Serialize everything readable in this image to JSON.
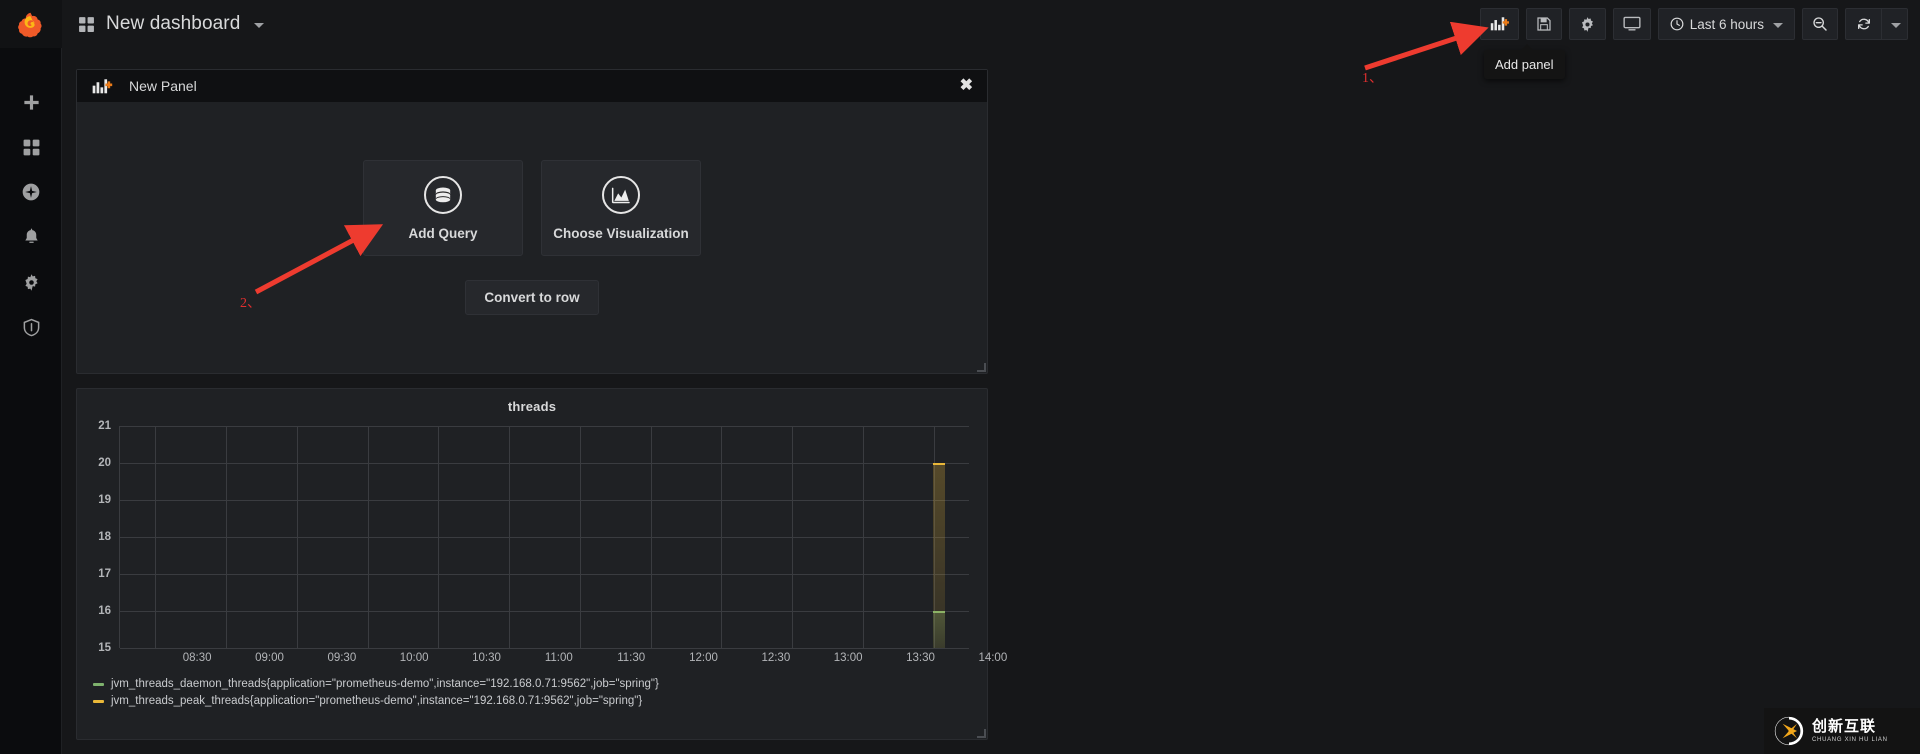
{
  "brand": {
    "logo": "grafana-logo",
    "accent": "#e0752d"
  },
  "sidebar": {
    "items": [
      {
        "name": "create",
        "icon": "plus-icon"
      },
      {
        "name": "dashboards",
        "icon": "dashboards-grid-icon"
      },
      {
        "name": "explore",
        "icon": "compass-icon"
      },
      {
        "name": "alerting",
        "icon": "bell-icon"
      },
      {
        "name": "configuration",
        "icon": "gear-icon"
      },
      {
        "name": "server-admin",
        "icon": "shield-icon"
      }
    ]
  },
  "topnav": {
    "grid_icon": "dashboard-grid-icon",
    "title": "New dashboard",
    "caret": "chevron-down-icon",
    "buttons": [
      {
        "name": "add-panel",
        "icon": "add-panel-icon",
        "tooltip": "Add panel"
      },
      {
        "name": "save-dashboard",
        "icon": "floppy-save-icon"
      },
      {
        "name": "dashboard-settings",
        "icon": "gear-icon"
      },
      {
        "name": "cycle-view-mode",
        "icon": "tv-monitor-icon"
      }
    ],
    "time_picker": {
      "icon": "clock-icon",
      "label": "Last 6 hours",
      "caret": "chevron-down-icon"
    },
    "zoom_out": {
      "name": "zoom-out",
      "icon": "search-minus-icon"
    },
    "refresh": {
      "name": "refresh",
      "icon": "refresh-icon"
    },
    "refresh_interval": {
      "name": "refresh-interval",
      "icon": "chevron-down-icon"
    }
  },
  "new_panel": {
    "header_icon": "add-panel-icon",
    "title": "New Panel",
    "close": "✖",
    "cards": [
      {
        "name": "add-query",
        "icon": "database-icon",
        "label": "Add Query"
      },
      {
        "name": "choose-visualization",
        "icon": "graph-area-icon",
        "label": "Choose Visualization"
      }
    ],
    "convert_label": "Convert to row"
  },
  "graph_panel": {
    "title": "threads"
  },
  "annotations": [
    {
      "name": "annotation-1",
      "label": "1、"
    },
    {
      "name": "annotation-2",
      "label": "2、"
    }
  ],
  "watermark": {
    "logo": "cx-logo",
    "cn": "创新互联",
    "en": "CHUANG XIN HU LIAN"
  },
  "chart_data": {
    "type": "line",
    "title": "threads",
    "xlabel": "",
    "ylabel": "",
    "ylim": [
      15,
      21
    ],
    "yticks": [
      21,
      20,
      19,
      18,
      17,
      16,
      15
    ],
    "x": [
      "08:30",
      "09:00",
      "09:30",
      "10:00",
      "10:30",
      "11:00",
      "11:30",
      "12:00",
      "12:30",
      "13:00",
      "13:30",
      "14:00"
    ],
    "xticks": [
      "08:30",
      "09:00",
      "09:30",
      "10:00",
      "10:30",
      "11:00",
      "11:30",
      "12:00",
      "12:30",
      "13:00",
      "13:30",
      "14:00"
    ],
    "grid": true,
    "legend_position": "bottom",
    "series": [
      {
        "name": "jvm_threads_daemon_threads{application=\"prometheus-demo\",instance=\"192.168.0.71:9562\",job=\"spring\"}",
        "color": "#7eb26d",
        "value_at_end": 16,
        "values": [
          null,
          null,
          null,
          null,
          null,
          null,
          null,
          null,
          null,
          null,
          null,
          16
        ]
      },
      {
        "name": "jvm_threads_peak_threads{application=\"prometheus-demo\",instance=\"192.168.0.71:9562\",job=\"spring\"}",
        "color": "#eab839",
        "value_at_end": 20,
        "values": [
          null,
          null,
          null,
          null,
          null,
          null,
          null,
          null,
          null,
          null,
          null,
          20
        ]
      }
    ]
  }
}
